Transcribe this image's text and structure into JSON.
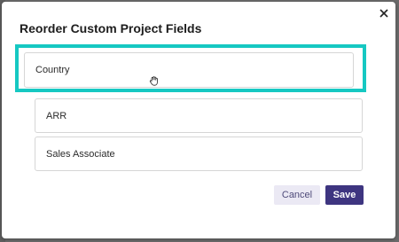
{
  "dialog": {
    "title": "Reorder Custom Project Fields",
    "close_icon": "close-icon"
  },
  "fields": [
    {
      "label": "Country",
      "state": "dragging"
    },
    {
      "label": "ARR"
    },
    {
      "label": "Sales Associate"
    }
  ],
  "cursor_icon": "grab-hand-icon",
  "highlight_color": "#16c8c2",
  "actions": {
    "cancel_label": "Cancel",
    "save_label": "Save"
  },
  "colors": {
    "primary": "#3e3580",
    "secondary_bg": "#ebe9f4"
  }
}
